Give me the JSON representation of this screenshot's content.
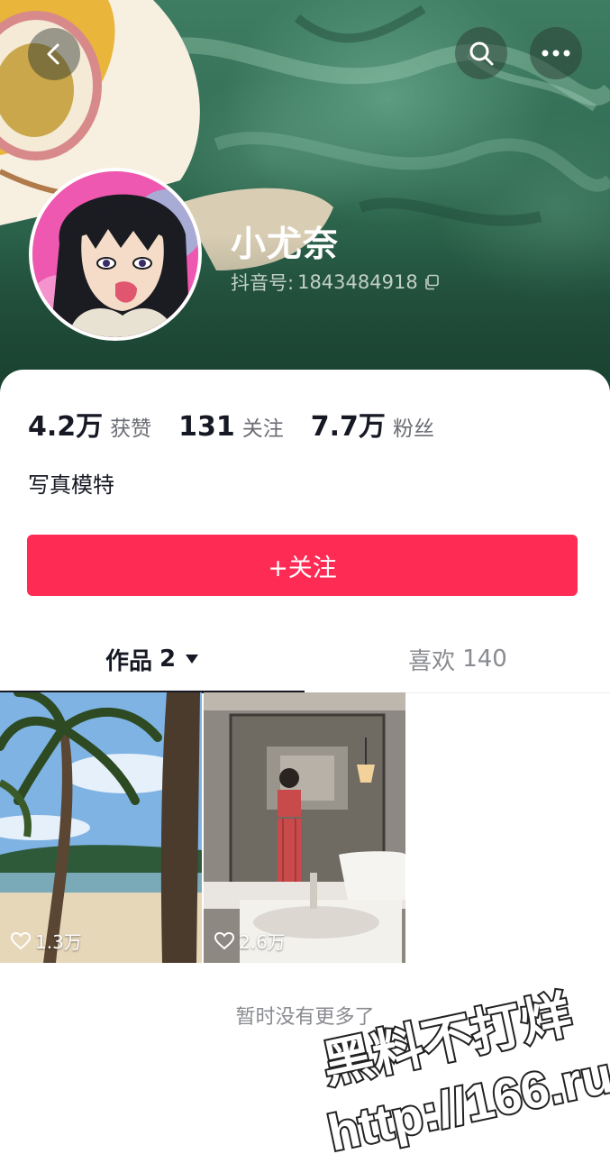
{
  "header": {
    "back_icon": "chevron-left-icon",
    "search_icon": "search-icon",
    "more_icon": "more-dots-icon"
  },
  "profile": {
    "nickname": "小尤奈",
    "account_label": "抖音号:",
    "account_id": "1843484918",
    "copy_icon": "copy-icon",
    "bio": "写真模特"
  },
  "stats": [
    {
      "value": "4.2万",
      "label": "获赞"
    },
    {
      "value": "131",
      "label": "关注"
    },
    {
      "value": "7.7万",
      "label": "粉丝"
    }
  ],
  "follow_button": {
    "label": "+关注",
    "color": "#fe2c55"
  },
  "tabs": [
    {
      "label": "作品",
      "count": "2",
      "active": true
    },
    {
      "label": "喜欢",
      "count": "140",
      "active": false
    }
  ],
  "videos": [
    {
      "likes": "1.3万",
      "scene": "beach-palm-trees"
    },
    {
      "likes": "2.6万",
      "scene": "bathroom-mirror-selfie"
    }
  ],
  "footer": {
    "no_more_text": "暂时没有更多了"
  },
  "watermark": {
    "line1": "黑料不打烊",
    "line2": "http://166.run"
  }
}
